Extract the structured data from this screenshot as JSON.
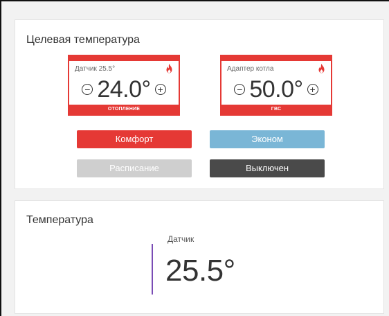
{
  "target": {
    "title": "Целевая температура",
    "heating": {
      "label": "Датчик 25.5°",
      "value": "24.0°",
      "footer": "ОТОПЛЕНИЕ",
      "minus": "−",
      "plus": "+"
    },
    "dhw": {
      "label": "Адаптер котла",
      "value": "50.0°",
      "footer": "ГВС",
      "minus": "−",
      "plus": "+"
    },
    "modes": {
      "comfort": "Комфорт",
      "econom": "Эконом",
      "schedule": "Расписание",
      "off": "Выключен"
    }
  },
  "temperature": {
    "title": "Температура",
    "sensor_label": "Датчик",
    "sensor_value": "25.5°"
  },
  "colors": {
    "accent_red": "#e53935",
    "econom_blue": "#7ab6d6",
    "schedule_gray": "#cfcfcf",
    "off_dark": "#4a4a4a",
    "sensor_purple": "#7a4cb5"
  }
}
